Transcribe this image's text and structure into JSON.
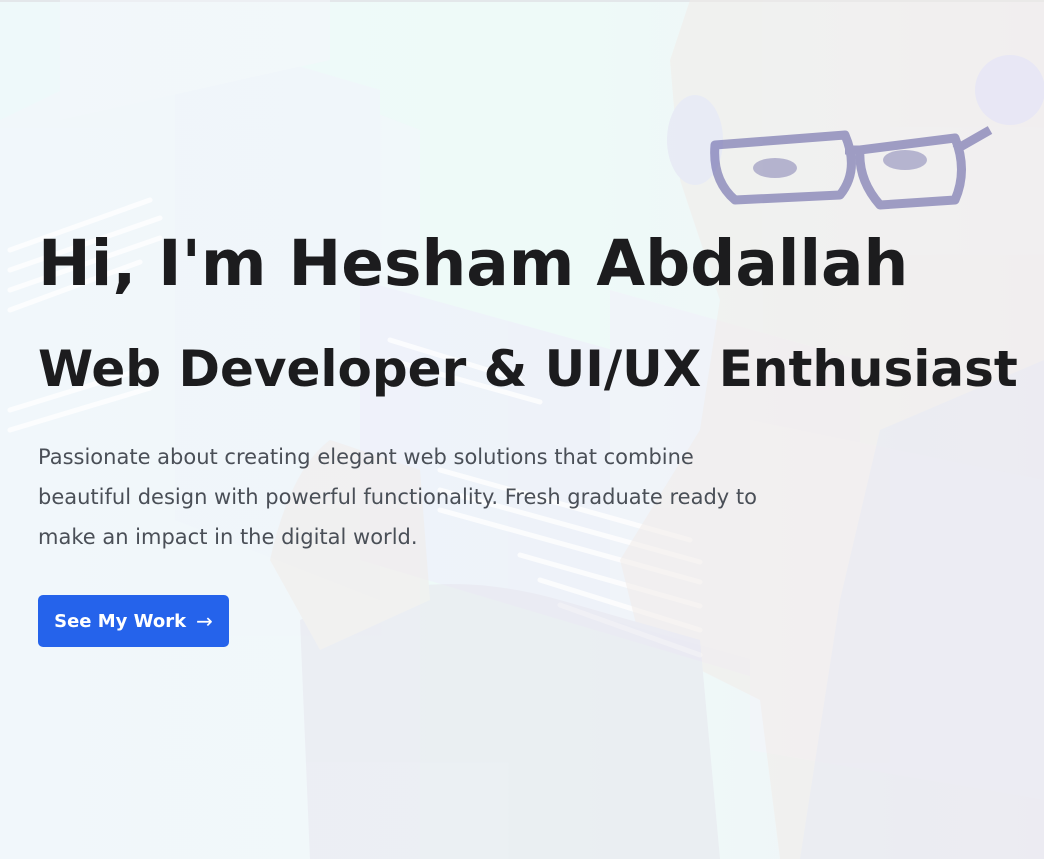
{
  "hero": {
    "title": "Hi, I'm Hesham Abdallah",
    "subtitle": "Web Developer & UI/UX Enthusiast",
    "description": "Passionate about creating elegant web solutions that combine beautiful design with powerful functionality. Fresh graduate ready to make an impact in the digital world.",
    "cta_label": "See My Work",
    "cta_icon": "arrow-right-icon",
    "cta_glyph": "→",
    "background_illustration": "developer-with-glasses-and-headphones-illustration"
  },
  "colors": {
    "accent": "#2563eb",
    "heading": "#1c1c1e",
    "body_text": "#4a4f57",
    "background": "#eef9fa"
  }
}
